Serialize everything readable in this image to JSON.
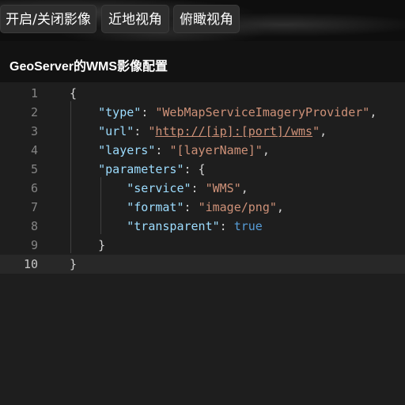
{
  "toolbar": {
    "buttons": [
      "开启/关闭影像",
      "近地视角",
      "俯瞰视角"
    ]
  },
  "panel": {
    "title": "GeoServer的WMS影像配置"
  },
  "editor": {
    "current_line": 10,
    "lines": [
      {
        "num": "1",
        "parts": [
          [
            "p",
            "{"
          ]
        ]
      },
      {
        "num": "2",
        "parts": [
          [
            "p",
            "    "
          ],
          [
            "k",
            "\"type\""
          ],
          [
            "p",
            ": "
          ],
          [
            "s",
            "\"WebMapServiceImageryProvider\""
          ],
          [
            "p",
            ","
          ]
        ]
      },
      {
        "num": "3",
        "parts": [
          [
            "p",
            "    "
          ],
          [
            "k",
            "\"url\""
          ],
          [
            "p",
            ": "
          ],
          [
            "s",
            "\""
          ],
          [
            "u",
            "http://[ip]:[port]/wms"
          ],
          [
            "s",
            "\""
          ],
          [
            "p",
            ","
          ]
        ]
      },
      {
        "num": "4",
        "parts": [
          [
            "p",
            "    "
          ],
          [
            "k",
            "\"layers\""
          ],
          [
            "p",
            ": "
          ],
          [
            "s",
            "\"[layerName]\""
          ],
          [
            "p",
            ","
          ]
        ]
      },
      {
        "num": "5",
        "parts": [
          [
            "p",
            "    "
          ],
          [
            "k",
            "\"parameters\""
          ],
          [
            "p",
            ": {"
          ]
        ]
      },
      {
        "num": "6",
        "parts": [
          [
            "p",
            "        "
          ],
          [
            "k",
            "\"service\""
          ],
          [
            "p",
            ": "
          ],
          [
            "s",
            "\"WMS\""
          ],
          [
            "p",
            ","
          ]
        ]
      },
      {
        "num": "7",
        "parts": [
          [
            "p",
            "        "
          ],
          [
            "k",
            "\"format\""
          ],
          [
            "p",
            ": "
          ],
          [
            "s",
            "\"image/png\""
          ],
          [
            "p",
            ","
          ]
        ]
      },
      {
        "num": "8",
        "parts": [
          [
            "p",
            "        "
          ],
          [
            "k",
            "\"transparent\""
          ],
          [
            "p",
            ": "
          ],
          [
            "b",
            "true"
          ]
        ]
      },
      {
        "num": "9",
        "parts": [
          [
            "p",
            "    }"
          ]
        ]
      },
      {
        "num": "10",
        "parts": [
          [
            "p",
            "}"
          ]
        ]
      }
    ]
  }
}
